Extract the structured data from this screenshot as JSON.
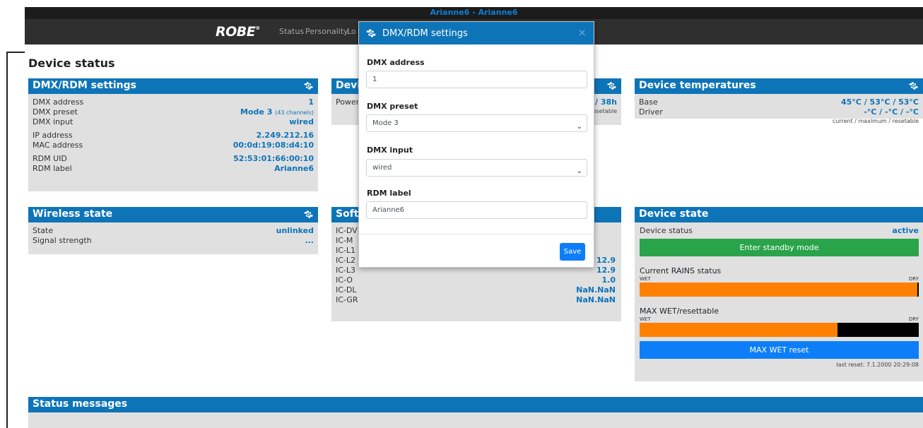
{
  "window": {
    "title": "Arianne6 - Arianne6"
  },
  "nav": {
    "logo": "ROBE",
    "logo_mark": "®",
    "items": [
      "Status",
      "Personality",
      "Lo"
    ]
  },
  "page": {
    "title": "Device status"
  },
  "dmx_card": {
    "title": "DMX/RDM settings",
    "rows": [
      {
        "k": "DMX address",
        "v": "1"
      },
      {
        "k": "DMX preset",
        "v": "Mode 3",
        "extra": "(43 channels)"
      },
      {
        "k": "DMX input",
        "v": "wired"
      },
      {
        "k": "IP address",
        "v": "2.249.212.16"
      },
      {
        "k": "MAC address",
        "v": "00:0d:19:08:d4:10"
      },
      {
        "k": "RDM UID",
        "v": "52:53:01:66:00:10"
      },
      {
        "k": "RDM label",
        "v": "Arianne6"
      }
    ]
  },
  "device_hours_card": {
    "title": "Devic",
    "row_k": "Power",
    "row_v": "/ 38h",
    "note": "esetable"
  },
  "temps_card": {
    "title": "Device temperatures",
    "rows": [
      {
        "k": "Base",
        "v": "45°C / 53°C / 53°C"
      },
      {
        "k": "Driver",
        "v": "-°C / -°C / -°C"
      }
    ],
    "note": "current / maximum / resetable"
  },
  "wireless_card": {
    "title": "Wireless state",
    "rows": [
      {
        "k": "State",
        "v": "unlinked"
      },
      {
        "k": "Signal strength",
        "v": "..."
      }
    ]
  },
  "software_card": {
    "title": "Softv",
    "rows": [
      {
        "k": "IC-DV",
        "v": ""
      },
      {
        "k": "IC-M",
        "v": ""
      },
      {
        "k": "IC-L1",
        "v": ""
      },
      {
        "k": "IC-L2",
        "v": "12.9"
      },
      {
        "k": "IC-L3",
        "v": "12.9"
      },
      {
        "k": "IC-O",
        "v": "1.0"
      },
      {
        "k": "IC-DL",
        "v": "NaN.NaN"
      },
      {
        "k": "IC-GR",
        "v": "NaN.NaN"
      }
    ]
  },
  "device_state_card": {
    "title": "Device state",
    "status_k": "Device status",
    "status_v": "active",
    "standby_button": "Enter standby mode",
    "rains_label": "Current RAINS status",
    "wet": "WET",
    "dry": "DRY",
    "rains_fraction": 0.995,
    "maxwet_label": "MAX WET/resettable",
    "maxwet_fraction": 0.71,
    "reset_button": "MAX WET reset",
    "last_reset": "last reset: 7.1.2000 20:29:08"
  },
  "status_messages": {
    "title": "Status messages"
  },
  "modal": {
    "title": "DMX/RDM settings",
    "close": "×",
    "address_label": "DMX address",
    "address_value": "1",
    "preset_label": "DMX preset",
    "preset_value": "Mode 3",
    "input_label": "DMX input",
    "input_value": "wired",
    "rdm_label": "RDM label",
    "rdm_value": "Arianne6",
    "save": "Save"
  },
  "colors": {
    "header_blue": "#0e74b8",
    "card_gray": "#e0e0e0",
    "green": "#2aa44a",
    "button_blue": "#0d7ef8",
    "orange": "#ff7f00"
  },
  "icons": {
    "card_settings": "gear-icon",
    "modal_close": "close-icon",
    "select_arrow": "chevron-down-icon"
  }
}
